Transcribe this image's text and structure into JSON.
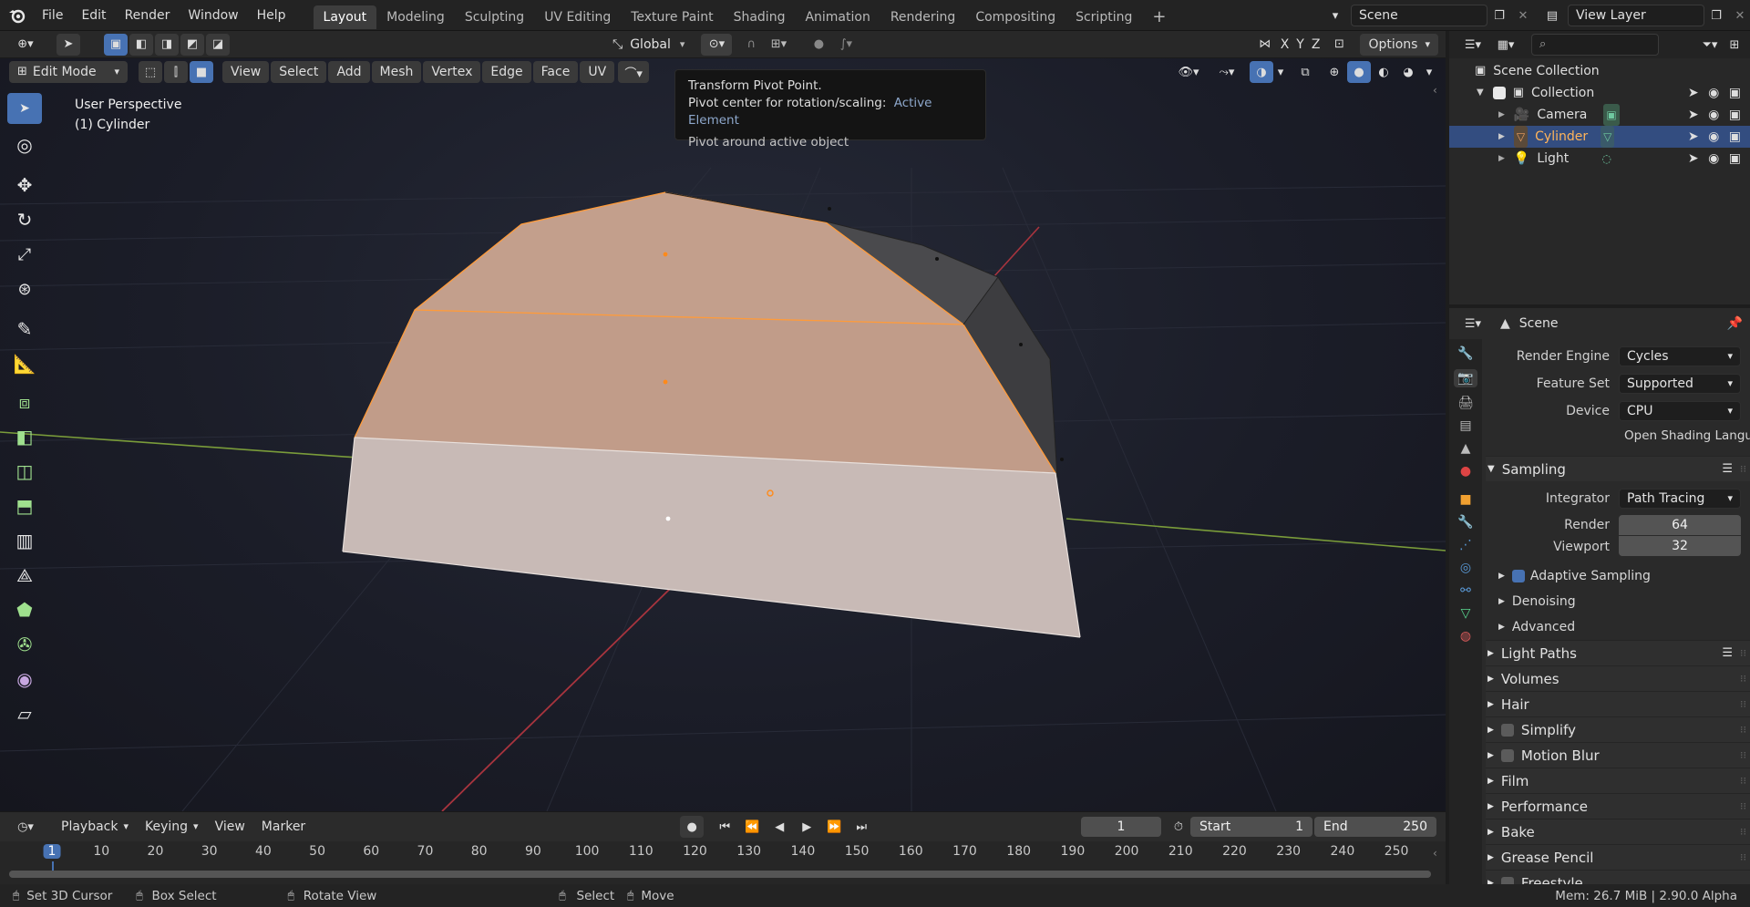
{
  "menus": [
    "File",
    "Edit",
    "Render",
    "Window",
    "Help"
  ],
  "workspaces": [
    "Layout",
    "Modeling",
    "Sculpting",
    "UV Editing",
    "Texture Paint",
    "Shading",
    "Animation",
    "Rendering",
    "Compositing",
    "Scripting"
  ],
  "active_workspace": "Layout",
  "plus_label": "+",
  "scene_name": "Scene",
  "view_layer_name": "View Layer",
  "viewport_header": {
    "transform_orientation": "Global",
    "axis_x": "X",
    "axis_y": "Y",
    "axis_z": "Z",
    "options_label": "Options"
  },
  "viewport_header2": {
    "mode": "Edit Mode",
    "menu_items": [
      "View",
      "Select",
      "Add",
      "Mesh",
      "Vertex",
      "Edge",
      "Face",
      "UV"
    ]
  },
  "viewport_overlay": {
    "perspective": "User Perspective",
    "object": "(1) Cylinder"
  },
  "tooltip": {
    "title": "Transform Pivot Point.",
    "line_prefix": "Pivot center for rotation/scaling:",
    "line_value": "Active Element",
    "description": "Pivot around active object"
  },
  "outliner": {
    "root": "Scene Collection",
    "collection": "Collection",
    "items": [
      {
        "name": "Camera",
        "selected": false
      },
      {
        "name": "Cylinder",
        "selected": true
      },
      {
        "name": "Light",
        "selected": false
      }
    ]
  },
  "properties": {
    "context": "Scene",
    "fields": [
      {
        "label": "Render Engine",
        "value": "Cycles"
      },
      {
        "label": "Feature Set",
        "value": "Supported"
      },
      {
        "label": "Device",
        "value": "CPU"
      }
    ],
    "osl_label": "Open Shading Langu...",
    "sampling": {
      "title": "Sampling",
      "integrator_label": "Integrator",
      "integrator_value": "Path Tracing",
      "render_label": "Render",
      "render_value": "64",
      "viewport_label": "Viewport",
      "viewport_value": "32",
      "subsections": [
        "Adaptive Sampling",
        "Denoising",
        "Advanced"
      ]
    },
    "sections": [
      "Light Paths",
      "Volumes",
      "Hair",
      "Simplify",
      "Motion Blur",
      "Film",
      "Performance",
      "Bake",
      "Grease Pencil",
      "Freestyle"
    ]
  },
  "timeline": {
    "menus": [
      "Playback",
      "Keying",
      "View",
      "Marker"
    ],
    "current_frame": "1",
    "start_label": "Start",
    "start_value": "1",
    "end_label": "End",
    "end_value": "250",
    "ruler": [
      "1",
      "10",
      "20",
      "30",
      "40",
      "50",
      "60",
      "70",
      "80",
      "90",
      "100",
      "110",
      "120",
      "130",
      "140",
      "150",
      "160",
      "170",
      "180",
      "190",
      "200",
      "210",
      "220",
      "230",
      "240",
      "250"
    ]
  },
  "statusbar": {
    "items": [
      "Set 3D Cursor",
      "Box Select",
      "Rotate View",
      "Select",
      "Move"
    ],
    "memory": "Mem: 26.7 MiB | 2.90.0 Alpha"
  },
  "colors": {
    "accent": "#4772b3",
    "selected_face": "#c9a28d",
    "edge_select": "#ff9b3a",
    "outliner_select": "#334d80"
  }
}
